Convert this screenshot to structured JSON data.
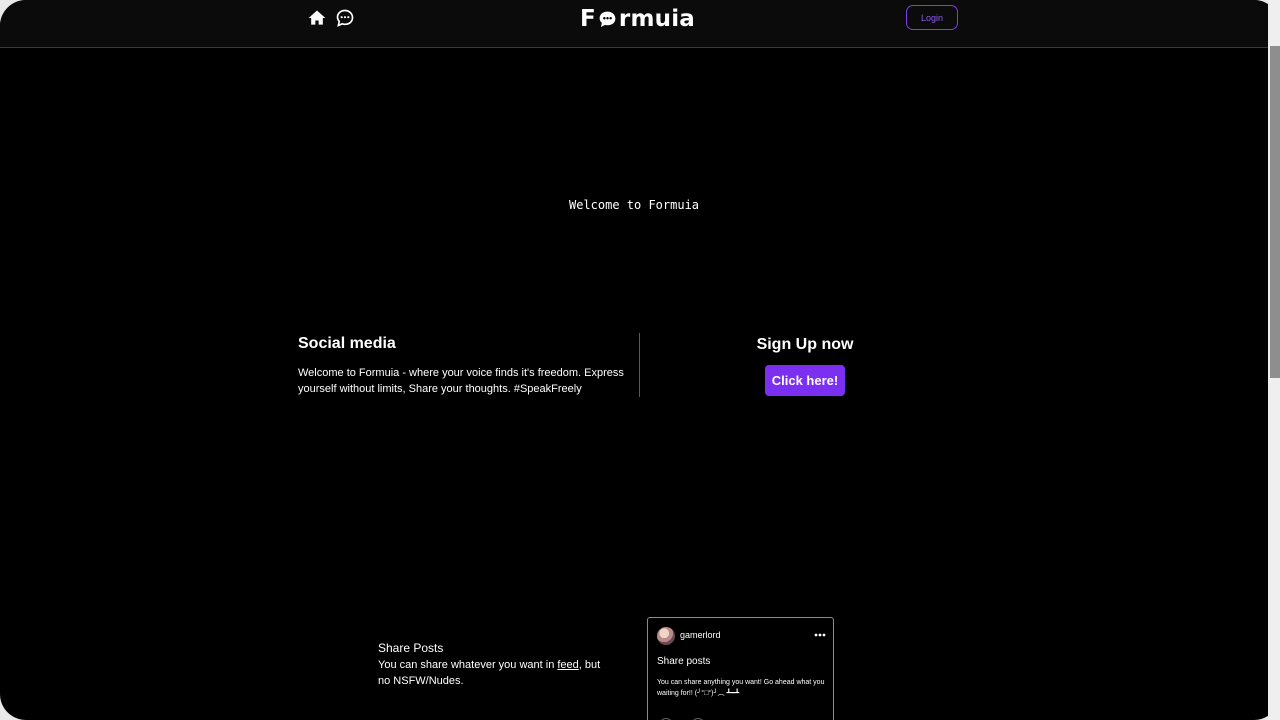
{
  "app": {
    "logo_text_left": "F",
    "logo_text_right": "rmuia",
    "login_label": "Login"
  },
  "hero": {
    "welcome_text": "Welcome to Formuia"
  },
  "about": {
    "title": "Social media",
    "description": "Welcome to Formuia - where your voice finds it's freedom. Express yourself without limits, Share your thoughts. #SpeakFreely"
  },
  "signup": {
    "title": "Sign Up now",
    "button_label": "Click here!"
  },
  "share": {
    "title": "Share Posts",
    "desc_prefix": "You can share whatever you want in ",
    "desc_link": "feed",
    "desc_suffix": ", but no NSFW/Nudes."
  },
  "post": {
    "username": "gamerlord",
    "title": "Share posts",
    "body": "You can share anything you want! Go ahead what you waiting for!! (╯°□°)╯︵ ┻━┻"
  },
  "icons": {
    "home": "home-icon",
    "chat": "chat-icon",
    "more": "more-dots-icon"
  },
  "colors": {
    "accent": "#7b2ff0",
    "background": "#000000",
    "topbar": "#0b0b0c"
  }
}
